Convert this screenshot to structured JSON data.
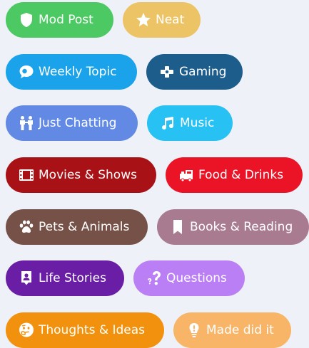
{
  "tags": [
    {
      "label": "Mod Post",
      "color": "#4cc963",
      "icon": "shield-icon"
    },
    {
      "label": "Neat",
      "color": "#edc465",
      "icon": "star-icon"
    },
    {
      "label": "Weekly Topic",
      "color": "#1aa3ea",
      "icon": "chat-bubble-icon"
    },
    {
      "label": "Gaming",
      "color": "#1d5d8c",
      "icon": "gamepad-icon"
    },
    {
      "label": "Just Chatting",
      "color": "#6289e3",
      "icon": "people-icon"
    },
    {
      "label": "Music",
      "color": "#28c1f3",
      "icon": "music-note-icon"
    },
    {
      "label": "Movies & Shows",
      "color": "#a81116",
      "icon": "film-icon"
    },
    {
      "label": "Food & Drinks",
      "color": "#ea1426",
      "icon": "food-truck-icon"
    },
    {
      "label": "Pets & Animals",
      "color": "#765147",
      "icon": "paw-icon"
    },
    {
      "label": "Books & Reading",
      "color": "#a87b91",
      "icon": "bookmark-icon"
    },
    {
      "label": "Life Stories",
      "color": "#6a1ea5",
      "icon": "person-card-icon"
    },
    {
      "label": "Questions",
      "color": "#ba7ff5",
      "icon": "question-icon"
    },
    {
      "label": "Thoughts & Ideas",
      "color": "#f1910d",
      "icon": "thinking-face-icon"
    },
    {
      "label": "Made did it",
      "color": "#f8b467",
      "icon": "exclamation-icon"
    }
  ]
}
